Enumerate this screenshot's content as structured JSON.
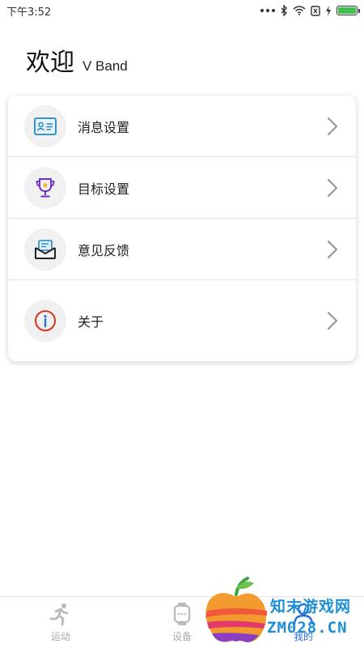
{
  "status_bar": {
    "time": "下午3:52",
    "icons": [
      "more-dots-icon",
      "bluetooth-icon",
      "wifi-icon",
      "sim-off-icon",
      "charging-icon",
      "battery-icon"
    ],
    "battery_level": 1.0
  },
  "header": {
    "title": "欢迎",
    "device_name": "V Band"
  },
  "menu": {
    "items": [
      {
        "label": "消息设置",
        "icon": "id-card-icon"
      },
      {
        "label": "目标设置",
        "icon": "trophy-icon"
      },
      {
        "label": "意见反馈",
        "icon": "feedback-mail-icon"
      },
      {
        "label": "关于",
        "icon": "info-icon"
      }
    ]
  },
  "tab_bar": {
    "tabs": [
      {
        "label": "运动",
        "icon": "running-icon",
        "active": false
      },
      {
        "label": "设备",
        "icon": "watch-icon",
        "active": false
      },
      {
        "label": "我的",
        "icon": "person-icon",
        "active": true
      }
    ]
  },
  "watermark": {
    "text": "知末游戏网",
    "domain": "ZM028.CN"
  },
  "colors": {
    "accent": "#2a6fd6",
    "inactive_tab": "#aaaaaa",
    "battery": "#3cc24a",
    "watermark": "#1e8fd6"
  }
}
